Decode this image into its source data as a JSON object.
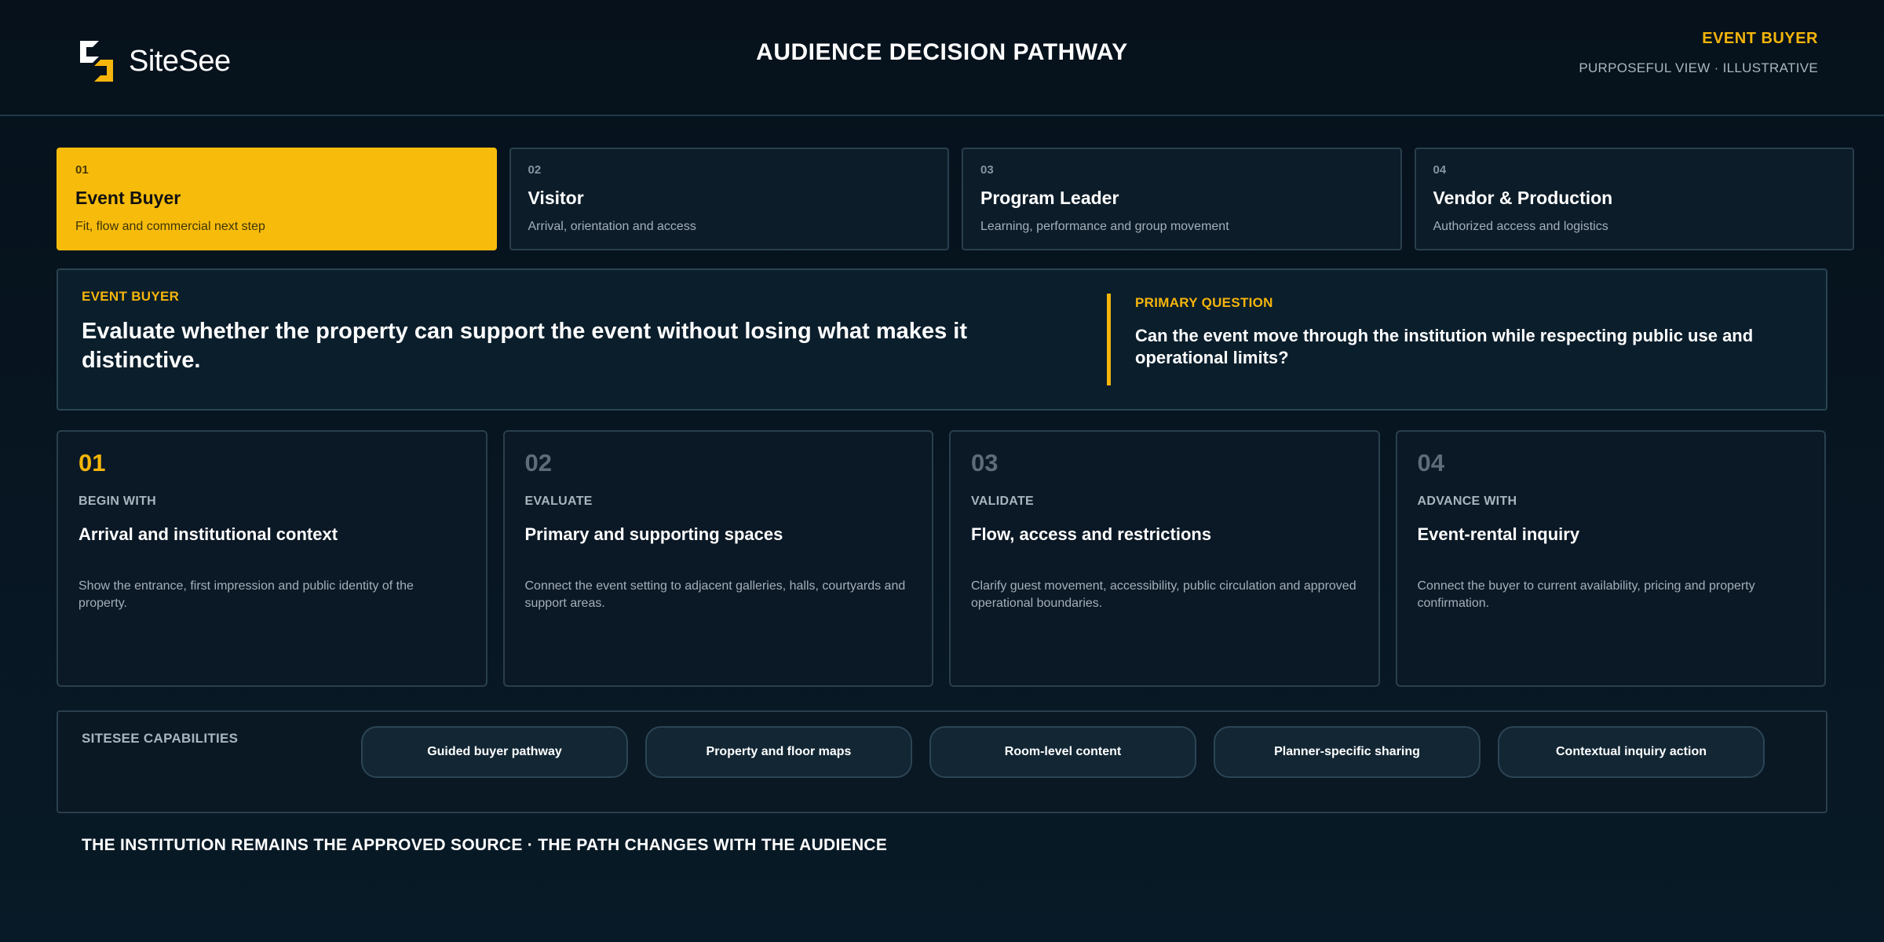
{
  "brand": {
    "name": "SiteSee",
    "logo_icon": "sitesee-s-logo-icon",
    "accent": "#f5b50a"
  },
  "header": {
    "title": "AUDIENCE DECISION PATHWAY",
    "audience": "EVENT BUYER",
    "subtitle": "PURPOSEFUL VIEW · ILLUSTRATIVE"
  },
  "audiences": [
    {
      "num": "01",
      "title": "Event Buyer",
      "desc": "Fit, flow and commercial next step",
      "active": true
    },
    {
      "num": "02",
      "title": "Visitor",
      "desc": "Arrival, orientation and access",
      "active": false
    },
    {
      "num": "03",
      "title": "Program Leader",
      "desc": "Learning, performance and group movement",
      "active": false
    },
    {
      "num": "04",
      "title": "Vendor & Production",
      "desc": "Authorized access and logistics",
      "active": false
    }
  ],
  "focus": {
    "label": "EVENT BUYER",
    "statement": "Evaluate whether the property can support the event without losing what makes it distinctive.",
    "question_label": "PRIMARY QUESTION",
    "question": "Can the event move through the institution while respecting public use and operational limits?"
  },
  "steps": [
    {
      "num": "01",
      "label": "BEGIN WITH",
      "title": "Arrival and institutional context",
      "desc": "Show the entrance, first impression and public identity of the property.",
      "active": true
    },
    {
      "num": "02",
      "label": "EVALUATE",
      "title": "Primary and supporting spaces",
      "desc": "Connect the event setting to adjacent galleries, halls, courtyards and support areas.",
      "active": false
    },
    {
      "num": "03",
      "label": "VALIDATE",
      "title": "Flow, access and restrictions",
      "desc": "Clarify guest movement, accessibility, public circulation and approved operational boundaries.",
      "active": false
    },
    {
      "num": "04",
      "label": "ADVANCE WITH",
      "title": "Event-rental inquiry",
      "desc": "Connect the buyer to current availability, pricing and property confirmation.",
      "active": false
    }
  ],
  "capabilities": {
    "label": "SITESEE CAPABILITIES",
    "items": [
      "Guided buyer pathway",
      "Property and floor maps",
      "Room-level content",
      "Planner-specific sharing",
      "Contextual inquiry action"
    ]
  },
  "footer": {
    "text": "THE INSTITUTION REMAINS THE APPROVED SOURCE · THE PATH CHANGES WITH THE AUDIENCE"
  }
}
